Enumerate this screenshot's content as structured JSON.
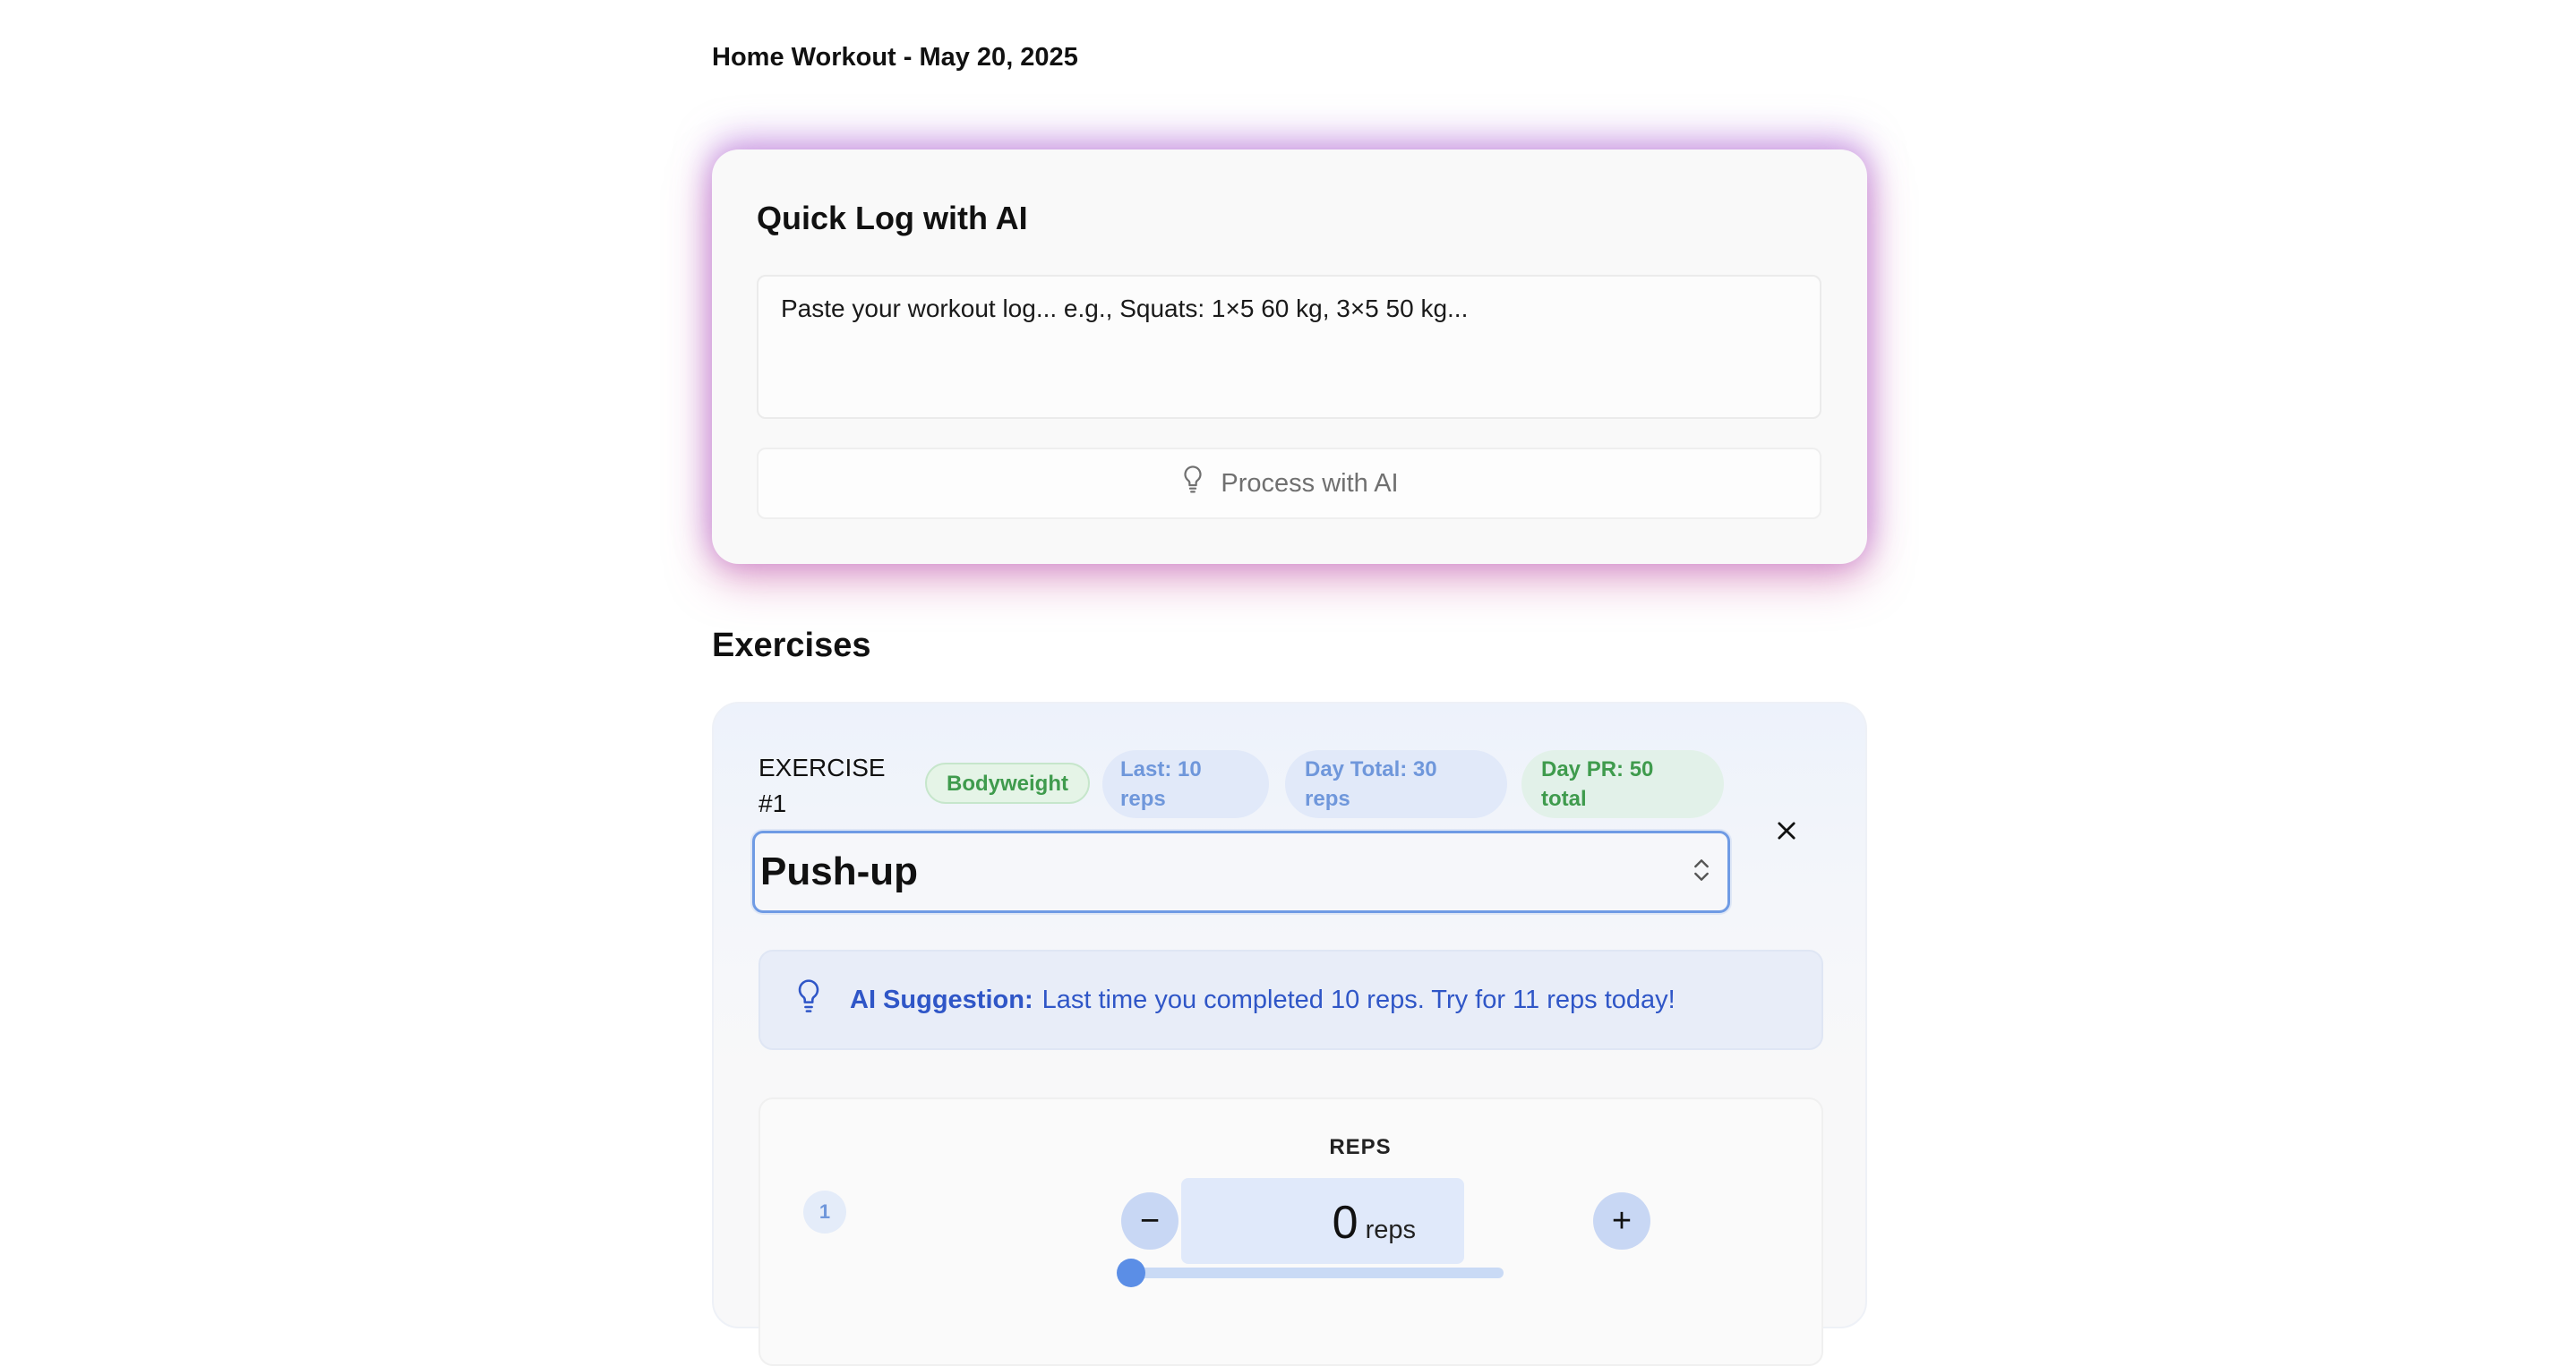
{
  "page": {
    "title": "Home Workout - May 20, 2025"
  },
  "quick_log": {
    "title": "Quick Log with AI",
    "textarea_placeholder": "Paste your workout log... e.g., Squats: 1×5 60 kg, 3×5 50 kg...",
    "process_button_label": "Process with AI",
    "process_icon": "lightbulb-icon"
  },
  "exercises": {
    "section_title": "Exercises",
    "items": [
      {
        "label": "EXERCISE #1",
        "badges": {
          "type": "Bodyweight",
          "last": "Last: 10 reps",
          "day_total": "Day Total: 30 reps",
          "day_pr": "Day PR: 50 total"
        },
        "selected_exercise": "Push-up",
        "remove_icon": "close-icon",
        "ai_suggestion": {
          "label": "AI Suggestion:",
          "text": "Last time you completed 10 reps. Try for 11 reps today!",
          "icon": "lightbulb-icon"
        },
        "sets": [
          {
            "number": "1",
            "field_label": "REPS",
            "value": "0",
            "unit": "reps",
            "decrement_symbol": "−",
            "increment_symbol": "+",
            "slider_fraction": 0
          }
        ]
      }
    ]
  },
  "colors": {
    "accent_blue": "#5b8ee6",
    "badge_green": "#3f9b4d",
    "badge_blue": "#6f97db",
    "suggestion_blue": "#2f56c7",
    "glow_pink": "#cd5aa0",
    "glow_purple": "#b987e6"
  }
}
